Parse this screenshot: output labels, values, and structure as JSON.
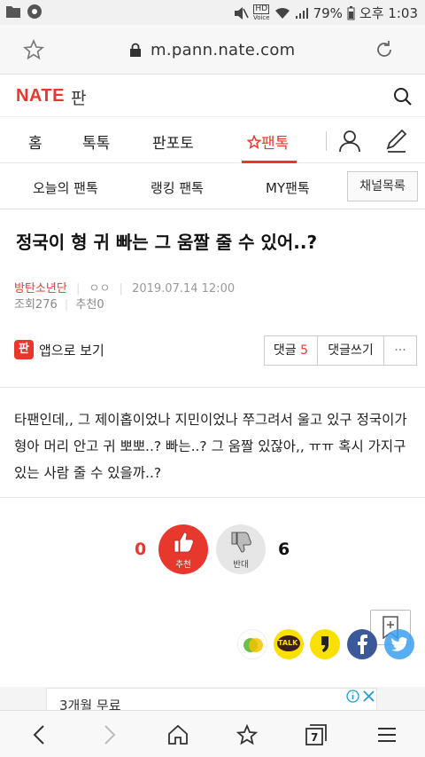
{
  "status_bar": {
    "time_text": "오후 1:03",
    "battery_pct": "79%",
    "hd_label": "HD",
    "voice_label": "Voice"
  },
  "browser": {
    "url": "m.pann.nate.com",
    "tab_count": "7"
  },
  "site": {
    "logo": "NATE",
    "logo_sub": "판",
    "nav_tabs": [
      "홈",
      "톡톡",
      "판포토",
      "팬톡"
    ],
    "active_nav_icon": "star-outline-icon",
    "sub_tabs": [
      "오늘의 팬톡",
      "랭킹 팬톡",
      "MY팬톡"
    ],
    "channel_button": "채널목록"
  },
  "post": {
    "title": "정국이 형 귀 빠는 그 움짤 줄 수 있어..?",
    "category": "방탄소년단",
    "author": "ㅇㅇ",
    "date": "2019.07.14 12:00",
    "views_label": "조회",
    "views": "276",
    "recommend_label": "추천",
    "recommend": "0",
    "body": "타팬인데,, 그 제이홉이었나 지민이었나 쭈그려서 울고 있구 정국이가 형아 머리 안고 귀 뽀뽀..? 빠는..? 그 움짤 있잖아,, ㅠㅠ 혹시 가지구 있는 사람 줄 수 있을까..?"
  },
  "actions": {
    "app_view_icon": "판",
    "app_view_label": "앱으로 보기",
    "comments_label": "댓글",
    "comments_count": "5",
    "write_comment_label": "댓글쓰기",
    "more_label": "···"
  },
  "vote": {
    "up_count": "0",
    "up_label": "추천",
    "down_count": "6",
    "down_label": "반대",
    "up_color": "#e8382d",
    "down_color": "#e6e6e6"
  },
  "share": {
    "services": [
      "kakaostory-icon",
      "kakaotalk-icon",
      "kakaopage-icon",
      "facebook-icon",
      "twitter-icon"
    ],
    "talk_label": "TALK",
    "colors": {
      "kakaotalk": "#f9e000",
      "facebook": "#3b5998",
      "twitter": "#3aa1f2"
    }
  },
  "ad": {
    "text": "3개월 무료"
  },
  "colors": {
    "accent": "#e8382d"
  }
}
